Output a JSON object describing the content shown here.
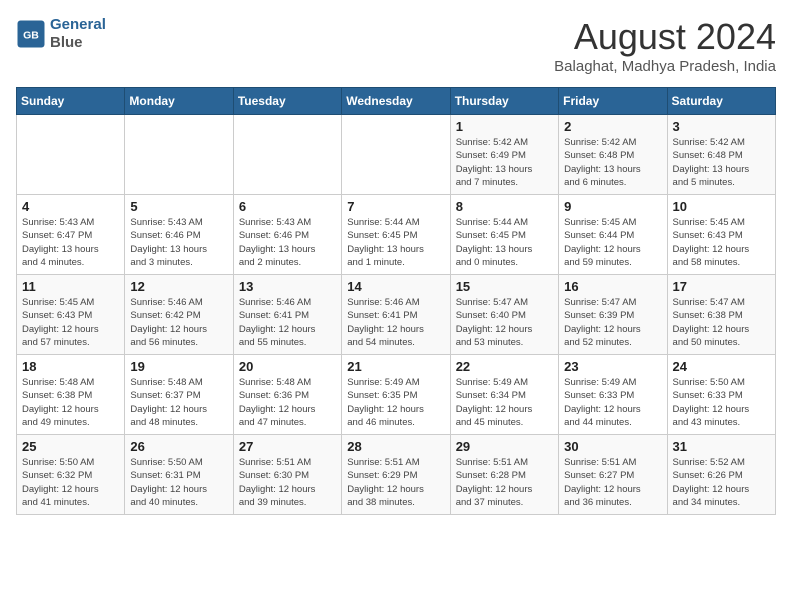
{
  "header": {
    "logo_line1": "General",
    "logo_line2": "Blue",
    "month_title": "August 2024",
    "location": "Balaghat, Madhya Pradesh, India"
  },
  "weekdays": [
    "Sunday",
    "Monday",
    "Tuesday",
    "Wednesday",
    "Thursday",
    "Friday",
    "Saturday"
  ],
  "weeks": [
    [
      {
        "day": "",
        "info": ""
      },
      {
        "day": "",
        "info": ""
      },
      {
        "day": "",
        "info": ""
      },
      {
        "day": "",
        "info": ""
      },
      {
        "day": "1",
        "info": "Sunrise: 5:42 AM\nSunset: 6:49 PM\nDaylight: 13 hours\nand 7 minutes."
      },
      {
        "day": "2",
        "info": "Sunrise: 5:42 AM\nSunset: 6:48 PM\nDaylight: 13 hours\nand 6 minutes."
      },
      {
        "day": "3",
        "info": "Sunrise: 5:42 AM\nSunset: 6:48 PM\nDaylight: 13 hours\nand 5 minutes."
      }
    ],
    [
      {
        "day": "4",
        "info": "Sunrise: 5:43 AM\nSunset: 6:47 PM\nDaylight: 13 hours\nand 4 minutes."
      },
      {
        "day": "5",
        "info": "Sunrise: 5:43 AM\nSunset: 6:46 PM\nDaylight: 13 hours\nand 3 minutes."
      },
      {
        "day": "6",
        "info": "Sunrise: 5:43 AM\nSunset: 6:46 PM\nDaylight: 13 hours\nand 2 minutes."
      },
      {
        "day": "7",
        "info": "Sunrise: 5:44 AM\nSunset: 6:45 PM\nDaylight: 13 hours\nand 1 minute."
      },
      {
        "day": "8",
        "info": "Sunrise: 5:44 AM\nSunset: 6:45 PM\nDaylight: 13 hours\nand 0 minutes."
      },
      {
        "day": "9",
        "info": "Sunrise: 5:45 AM\nSunset: 6:44 PM\nDaylight: 12 hours\nand 59 minutes."
      },
      {
        "day": "10",
        "info": "Sunrise: 5:45 AM\nSunset: 6:43 PM\nDaylight: 12 hours\nand 58 minutes."
      }
    ],
    [
      {
        "day": "11",
        "info": "Sunrise: 5:45 AM\nSunset: 6:43 PM\nDaylight: 12 hours\nand 57 minutes."
      },
      {
        "day": "12",
        "info": "Sunrise: 5:46 AM\nSunset: 6:42 PM\nDaylight: 12 hours\nand 56 minutes."
      },
      {
        "day": "13",
        "info": "Sunrise: 5:46 AM\nSunset: 6:41 PM\nDaylight: 12 hours\nand 55 minutes."
      },
      {
        "day": "14",
        "info": "Sunrise: 5:46 AM\nSunset: 6:41 PM\nDaylight: 12 hours\nand 54 minutes."
      },
      {
        "day": "15",
        "info": "Sunrise: 5:47 AM\nSunset: 6:40 PM\nDaylight: 12 hours\nand 53 minutes."
      },
      {
        "day": "16",
        "info": "Sunrise: 5:47 AM\nSunset: 6:39 PM\nDaylight: 12 hours\nand 52 minutes."
      },
      {
        "day": "17",
        "info": "Sunrise: 5:47 AM\nSunset: 6:38 PM\nDaylight: 12 hours\nand 50 minutes."
      }
    ],
    [
      {
        "day": "18",
        "info": "Sunrise: 5:48 AM\nSunset: 6:38 PM\nDaylight: 12 hours\nand 49 minutes."
      },
      {
        "day": "19",
        "info": "Sunrise: 5:48 AM\nSunset: 6:37 PM\nDaylight: 12 hours\nand 48 minutes."
      },
      {
        "day": "20",
        "info": "Sunrise: 5:48 AM\nSunset: 6:36 PM\nDaylight: 12 hours\nand 47 minutes."
      },
      {
        "day": "21",
        "info": "Sunrise: 5:49 AM\nSunset: 6:35 PM\nDaylight: 12 hours\nand 46 minutes."
      },
      {
        "day": "22",
        "info": "Sunrise: 5:49 AM\nSunset: 6:34 PM\nDaylight: 12 hours\nand 45 minutes."
      },
      {
        "day": "23",
        "info": "Sunrise: 5:49 AM\nSunset: 6:33 PM\nDaylight: 12 hours\nand 44 minutes."
      },
      {
        "day": "24",
        "info": "Sunrise: 5:50 AM\nSunset: 6:33 PM\nDaylight: 12 hours\nand 43 minutes."
      }
    ],
    [
      {
        "day": "25",
        "info": "Sunrise: 5:50 AM\nSunset: 6:32 PM\nDaylight: 12 hours\nand 41 minutes."
      },
      {
        "day": "26",
        "info": "Sunrise: 5:50 AM\nSunset: 6:31 PM\nDaylight: 12 hours\nand 40 minutes."
      },
      {
        "day": "27",
        "info": "Sunrise: 5:51 AM\nSunset: 6:30 PM\nDaylight: 12 hours\nand 39 minutes."
      },
      {
        "day": "28",
        "info": "Sunrise: 5:51 AM\nSunset: 6:29 PM\nDaylight: 12 hours\nand 38 minutes."
      },
      {
        "day": "29",
        "info": "Sunrise: 5:51 AM\nSunset: 6:28 PM\nDaylight: 12 hours\nand 37 minutes."
      },
      {
        "day": "30",
        "info": "Sunrise: 5:51 AM\nSunset: 6:27 PM\nDaylight: 12 hours\nand 36 minutes."
      },
      {
        "day": "31",
        "info": "Sunrise: 5:52 AM\nSunset: 6:26 PM\nDaylight: 12 hours\nand 34 minutes."
      }
    ]
  ]
}
